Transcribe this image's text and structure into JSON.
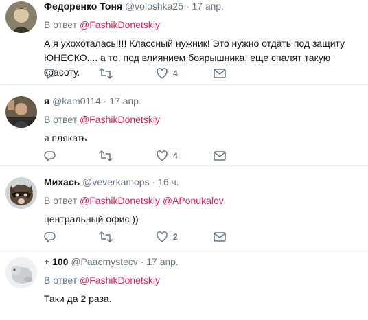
{
  "tweets": [
    {
      "name": "Федоренко Тоня",
      "handle": "@voloshka25",
      "dot": "·",
      "time": "17 апр.",
      "reply_prefix": "В ответ",
      "mentions": [
        "@FashikDonetskiy"
      ],
      "text": "А я ухохоталась!!!! Классный нужник! Это нужно отдать под защиту ЮНЕСКО.... а то, под влиянием боярышника, еще спалят такую красоту.",
      "likes": "4"
    },
    {
      "name": "я",
      "handle": "@kam0114",
      "dot": "·",
      "time": "17 апр.",
      "reply_prefix": "В ответ",
      "mentions": [
        "@FashikDonetskiy"
      ],
      "text": "я плякать",
      "likes": "4"
    },
    {
      "name": "Михась",
      "handle": "@veverkamops",
      "dot": "·",
      "time": "16 ч.",
      "reply_prefix": "В ответ",
      "mentions": [
        "@FashikDonetskiy",
        "@APonukalov"
      ],
      "text": "центральный  офис ))",
      "likes": "2"
    },
    {
      "name": "+ 100",
      "handle": "@Paacmystecv",
      "dot": "·",
      "time": "17 апр.",
      "reply_prefix": "В ответ",
      "mentions": [
        "@FashikDonetskiy"
      ],
      "text": "Таки да 2 раза."
    }
  ],
  "icons": {
    "reply": "reply-icon",
    "retweet": "retweet-icon",
    "like": "heart-icon",
    "message": "envelope-icon"
  },
  "colors": {
    "mention": "#e0245e",
    "muted": "#657786",
    "divider": "#e6ecf0"
  }
}
